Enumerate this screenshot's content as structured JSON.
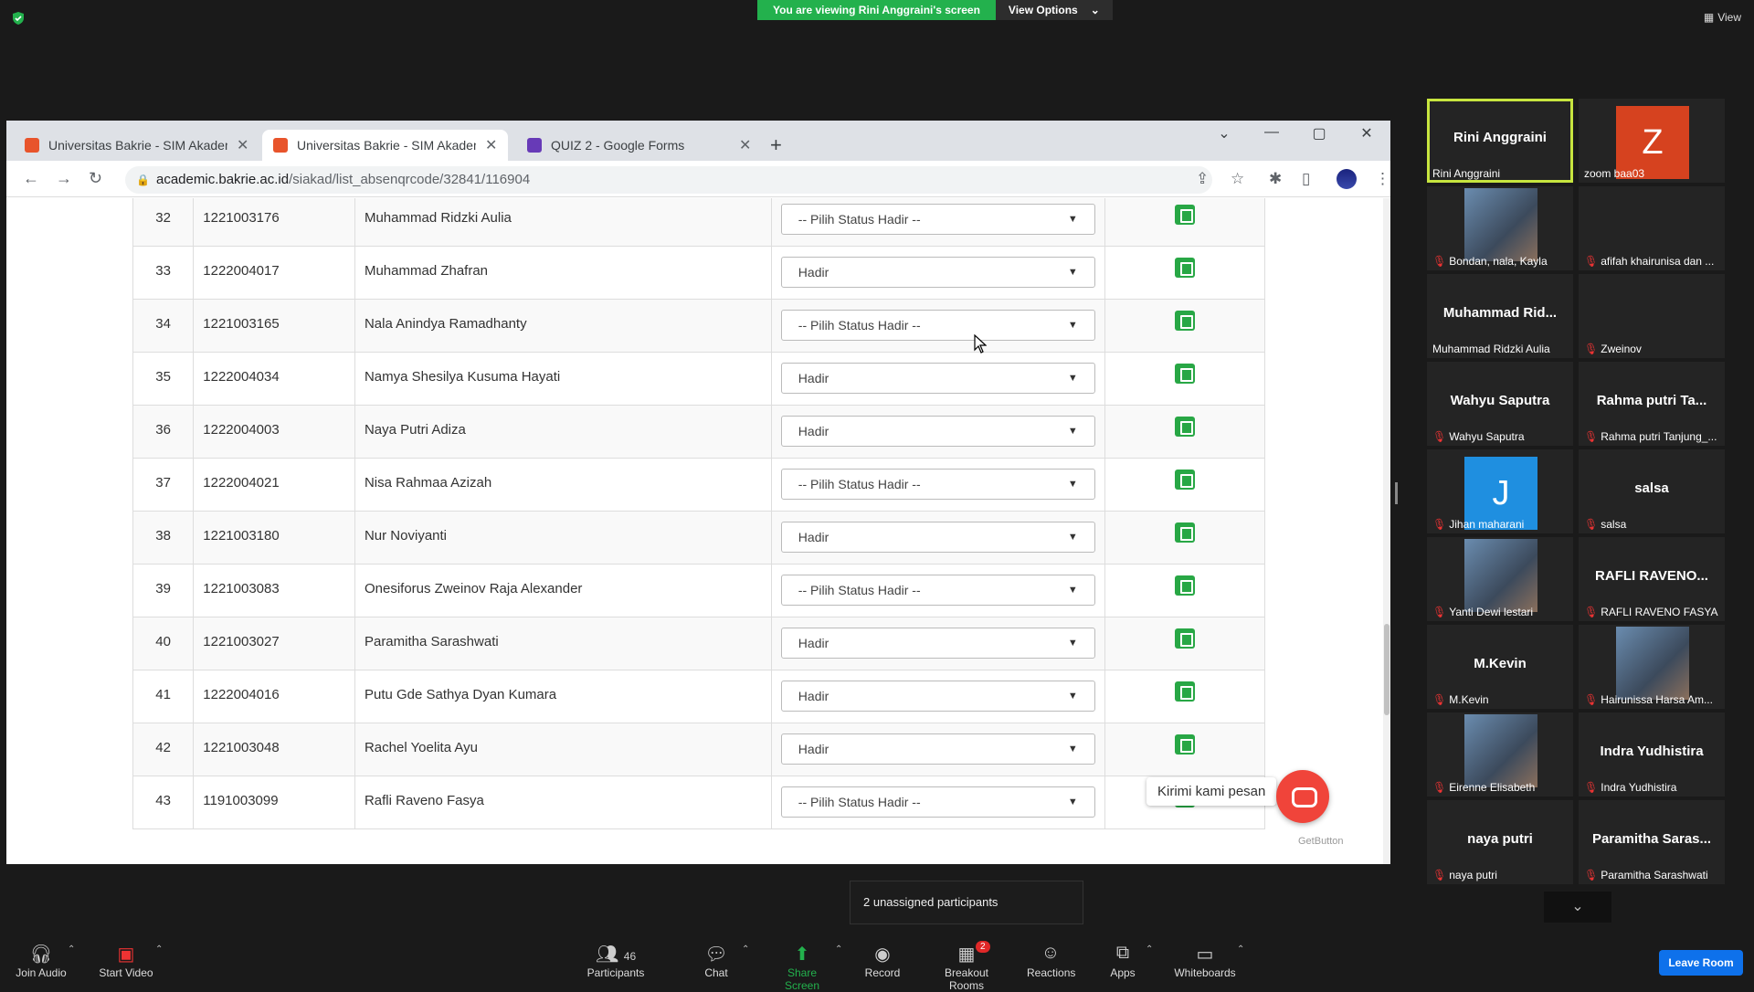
{
  "zoom": {
    "viewing_banner": "You are viewing Rini Anggraini's screen",
    "view_options": "View Options",
    "view_button": "View",
    "unassigned": "2 unassigned participants",
    "toolbar": {
      "join_audio": "Join Audio",
      "start_video": "Start Video",
      "participants": "Participants",
      "participants_count": "46",
      "chat": "Chat",
      "share_screen": "Share Screen",
      "record": "Record",
      "breakout_rooms": "Breakout Rooms",
      "breakout_badge": "2",
      "reactions": "Reactions",
      "apps": "Apps",
      "whiteboards": "Whiteboards",
      "leave": "Leave Room"
    }
  },
  "browser": {
    "tabs": [
      {
        "label": "Universitas Bakrie - SIM Akadem",
        "favicon_color": "#e8542b"
      },
      {
        "label": "Universitas Bakrie - SIM Akadem",
        "favicon_color": "#e8542b"
      },
      {
        "label": "QUIZ 2 - Google Forms",
        "favicon_color": "#673ab7"
      }
    ],
    "url_host": "academic.bakrie.ac.id",
    "url_path": "/siakad/list_absenqrcode/32841/116904"
  },
  "attendance": {
    "rows": [
      {
        "no": "32",
        "nim": "1221003176",
        "nama": "Muhammad Ridzki Aulia",
        "status": "-- Pilih Status Hadir --"
      },
      {
        "no": "33",
        "nim": "1222004017",
        "nama": "Muhammad Zhafran",
        "status": "Hadir"
      },
      {
        "no": "34",
        "nim": "1221003165",
        "nama": "Nala Anindya Ramadhanty",
        "status": "-- Pilih Status Hadir --"
      },
      {
        "no": "35",
        "nim": "1222004034",
        "nama": "Namya Shesilya Kusuma Hayati",
        "status": "Hadir"
      },
      {
        "no": "36",
        "nim": "1222004003",
        "nama": "Naya Putri Adiza",
        "status": "Hadir"
      },
      {
        "no": "37",
        "nim": "1222004021",
        "nama": "Nisa Rahmaa Azizah",
        "status": "-- Pilih Status Hadir --"
      },
      {
        "no": "38",
        "nim": "1221003180",
        "nama": "Nur Noviyanti",
        "status": "Hadir"
      },
      {
        "no": "39",
        "nim": "1221003083",
        "nama": "Onesiforus Zweinov Raja Alexander",
        "status": "-- Pilih Status Hadir --"
      },
      {
        "no": "40",
        "nim": "1221003027",
        "nama": "Paramitha Sarashwati",
        "status": "Hadir"
      },
      {
        "no": "41",
        "nim": "1222004016",
        "nama": "Putu Gde Sathya Dyan Kumara",
        "status": "Hadir"
      },
      {
        "no": "42",
        "nim": "1221003048",
        "nama": "Rachel Yoelita Ayu",
        "status": "Hadir"
      },
      {
        "no": "43",
        "nim": "1191003099",
        "nama": "Rafli Raveno Fasya",
        "status": "-- Pilih Status Hadir --"
      }
    ],
    "chat_label": "Kirimi kami pesan",
    "getbutton": "GetButton"
  },
  "gallery": [
    {
      "big": "Rini Anggraini",
      "name": "Rini Anggraini",
      "muted": false,
      "active": true
    },
    {
      "letter": "Z",
      "letter_bg": "#d6421f",
      "name": "zoom baa03",
      "muted": false
    },
    {
      "photo": true,
      "name": "Bondan, nala, Kayla",
      "muted": true
    },
    {
      "name": "afifah khairunisa dan ...",
      "muted": true
    },
    {
      "big": "Muhammad  Rid...",
      "name": "Muhammad Ridzki Aulia",
      "muted": false
    },
    {
      "name": "Zweinov",
      "muted": true
    },
    {
      "big": "Wahyu Saputra",
      "name": "Wahyu Saputra",
      "muted": true
    },
    {
      "big": "Rahma putri Ta...",
      "name": "Rahma putri Tanjung_...",
      "muted": true
    },
    {
      "letter": "J",
      "letter_bg": "#1f8fe0",
      "name": "Jihan maharani",
      "muted": true
    },
    {
      "big": "salsa",
      "name": "salsa",
      "muted": true
    },
    {
      "photo": true,
      "name": "Yanti Dewi lestari",
      "muted": true
    },
    {
      "big": "RAFLI  RAVENO...",
      "name": "RAFLI RAVENO FASYA",
      "muted": true
    },
    {
      "big": "M.Kevin",
      "name": "M.Kevin",
      "muted": true
    },
    {
      "photo": true,
      "name": "Hairunissa Harsa Am...",
      "muted": true
    },
    {
      "photo": true,
      "name": "Eirenne Elisabeth",
      "muted": true
    },
    {
      "big": "Indra Yudhistira",
      "name": "Indra Yudhistira",
      "muted": true
    },
    {
      "big": "naya putri",
      "name": "naya putri",
      "muted": true
    },
    {
      "big": "Paramitha  Saras...",
      "name": "Paramitha Sarashwati",
      "muted": true
    }
  ]
}
